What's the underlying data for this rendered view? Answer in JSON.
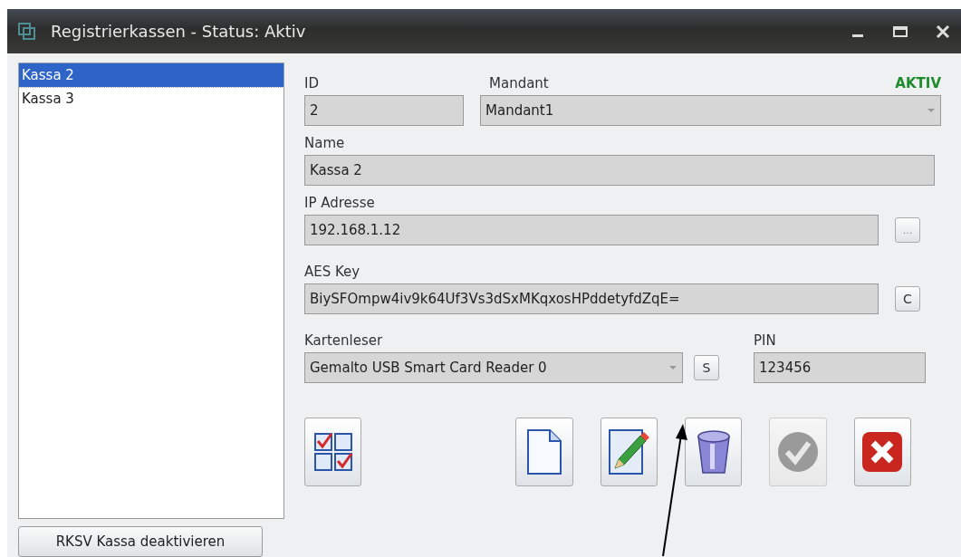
{
  "window": {
    "title": "Registrierkassen - Status: Aktiv"
  },
  "list": {
    "items": [
      {
        "label": "Kassa 2",
        "selected": true
      },
      {
        "label": "Kassa 3",
        "selected": false
      }
    ]
  },
  "deactivate_button": {
    "label": "RKSV Kassa deaktivieren"
  },
  "form": {
    "id": {
      "label": "ID",
      "value": "2"
    },
    "mandant": {
      "label": "Mandant",
      "value": "Mandant1"
    },
    "status": "AKTIV",
    "name": {
      "label": "Name",
      "value": "Kassa 2"
    },
    "ip": {
      "label": "IP Adresse",
      "value": "192.168.1.12",
      "button": "..."
    },
    "aes": {
      "label": "AES Key",
      "value": "BiySFOmpw4iv9k64Uf3Vs3dSxMKqxosHPddetyfdZqE=",
      "button": "C"
    },
    "card_reader": {
      "label": "Kartenleser",
      "value": "Gemalto USB Smart Card Reader 0",
      "button": "S"
    },
    "pin": {
      "label": "PIN",
      "value": "123456"
    }
  },
  "toolbar": [
    {
      "kind": "checklist",
      "disabled": false
    },
    {
      "kind": "new",
      "disabled": false
    },
    {
      "kind": "edit",
      "disabled": false
    },
    {
      "kind": "delete",
      "disabled": false
    },
    {
      "kind": "confirm",
      "disabled": true
    },
    {
      "kind": "cancel",
      "disabled": false
    }
  ]
}
